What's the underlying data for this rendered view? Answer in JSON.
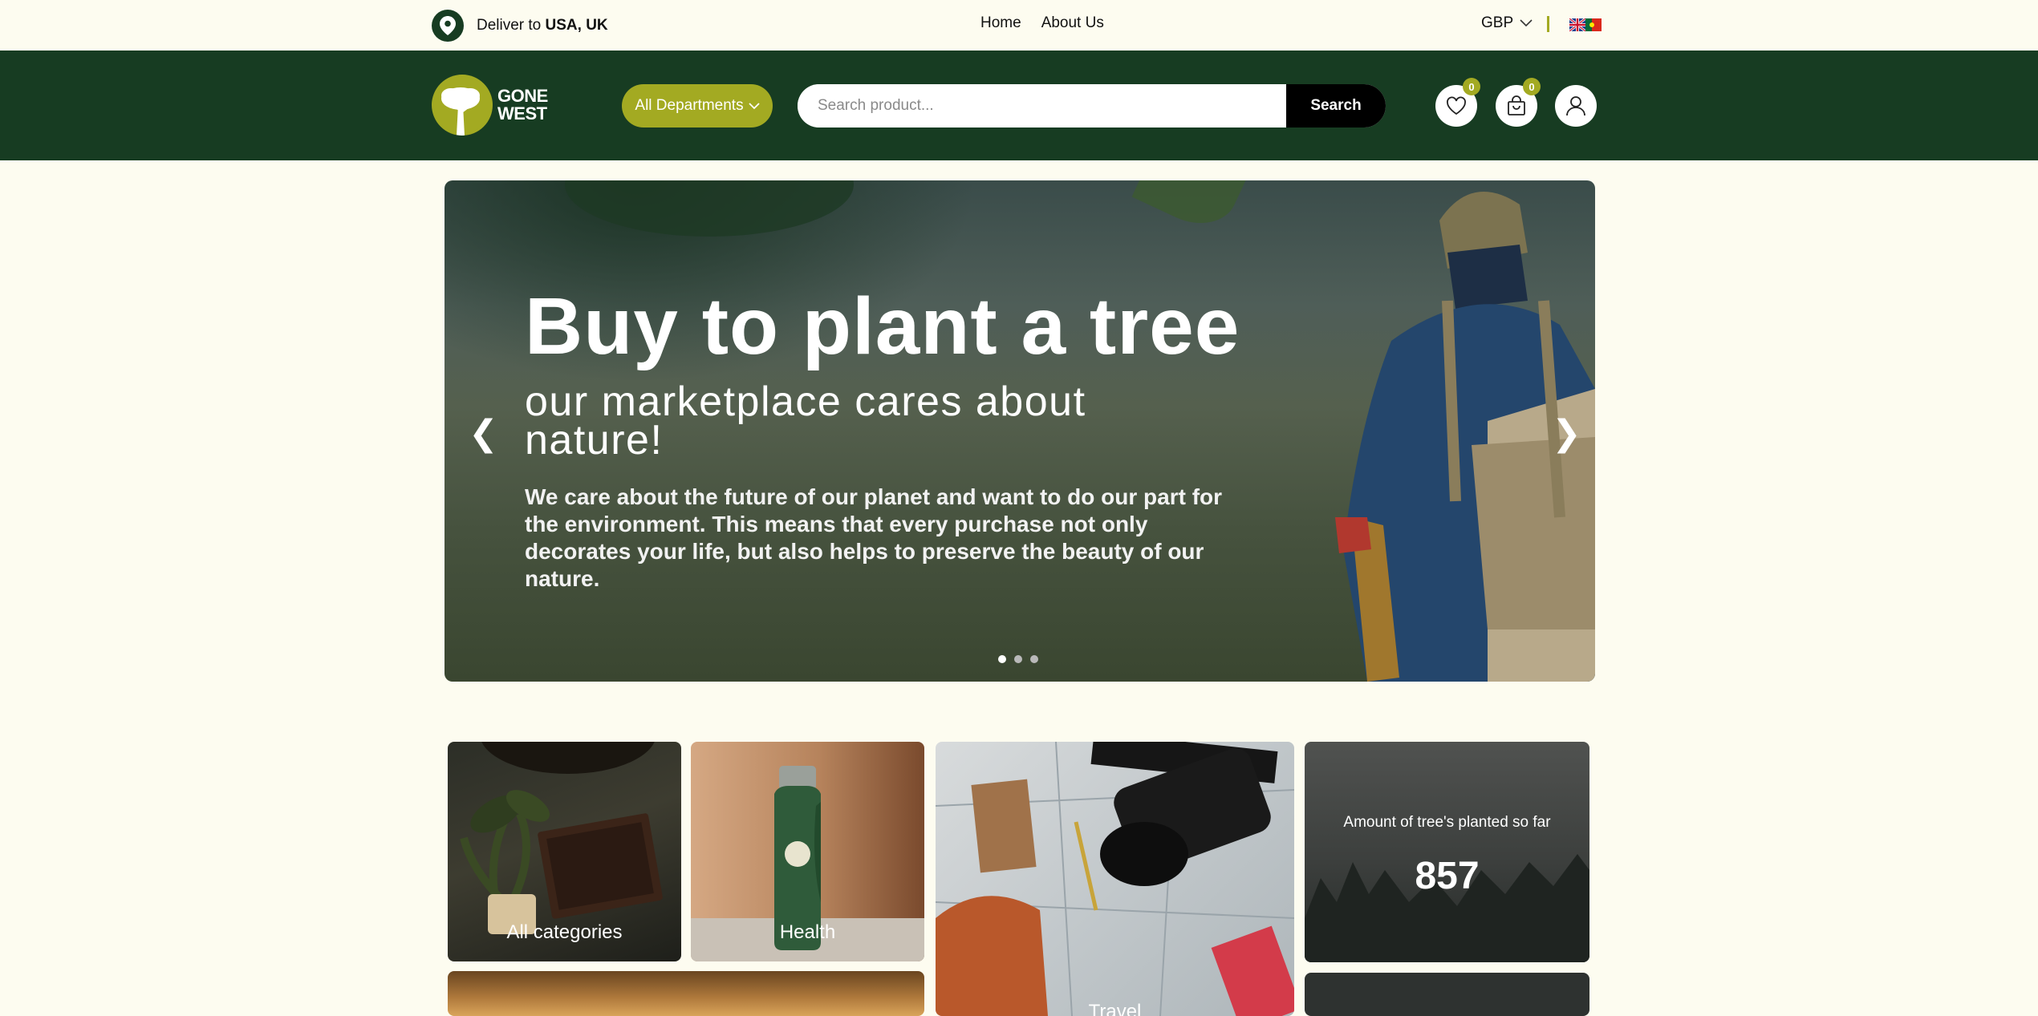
{
  "topbar": {
    "deliver_prefix": "Deliver to",
    "deliver_location": "USA, UK",
    "nav": [
      "Home",
      "About Us"
    ],
    "currency": "GBP"
  },
  "header": {
    "logo_line1": "GONE",
    "logo_line2": "WEST",
    "departments_label": "All Departments",
    "search_placeholder": "Search product...",
    "search_button": "Search",
    "wishlist_count": "0",
    "cart_count": "0"
  },
  "hero": {
    "title": "Buy to plant a tree",
    "subtitle": "our marketplace cares about nature!",
    "description": "We care about the future of our planet and want to do our part for the environment. This means that every purchase not only decorates your life, but also helps to preserve the beauty of our nature.",
    "prev_arrow": "❮",
    "next_arrow": "❯",
    "active_slide": 1,
    "slide_count": 3
  },
  "tiles": {
    "all_categories": "All categories",
    "health": "Health",
    "travel": "Travel",
    "trees_caption": "Amount of tree's planted so far",
    "trees_count": "857"
  },
  "colors": {
    "header_green": "#173c22",
    "accent_olive": "#a3aa22",
    "background": "#fdfcf0"
  },
  "icons": [
    "location-pin-icon",
    "chevron-down-icon",
    "uk-flag-icon",
    "portugal-flag-icon",
    "heart-icon",
    "shopping-bag-icon",
    "user-icon"
  ]
}
